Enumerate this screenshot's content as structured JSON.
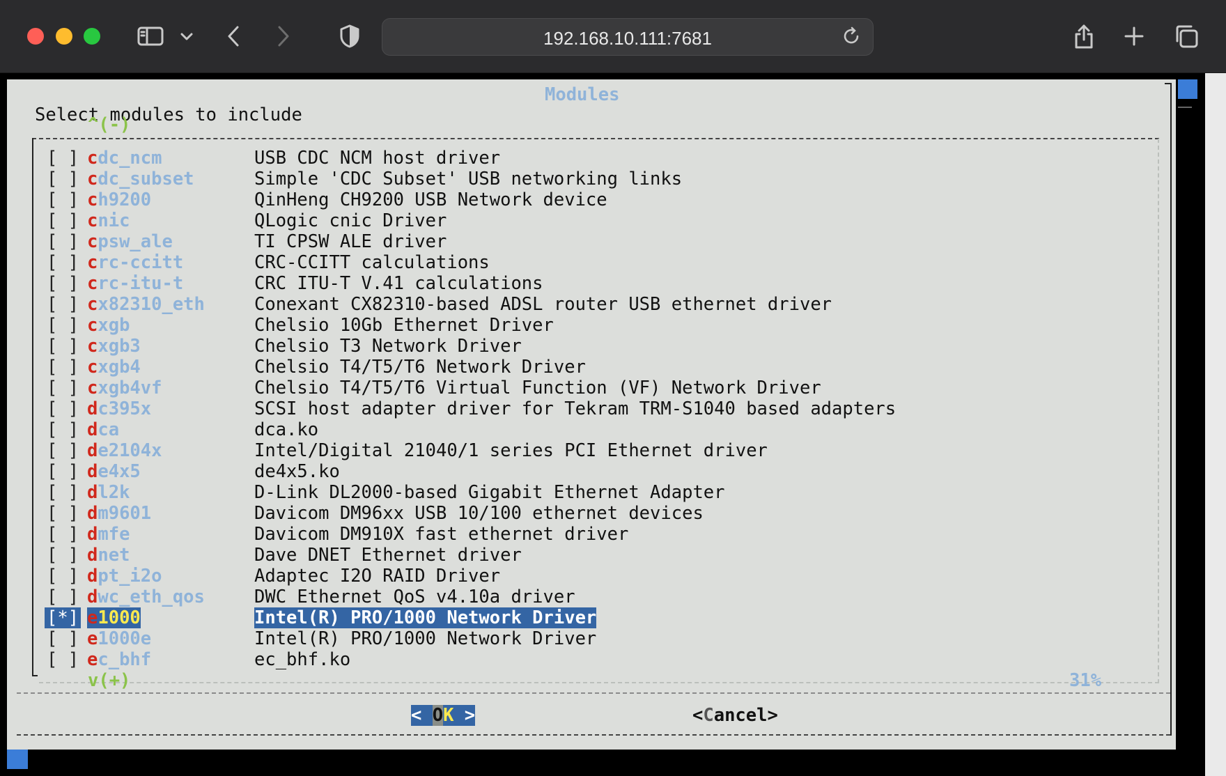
{
  "browser": {
    "url": "192.168.10.111:7681"
  },
  "dialog": {
    "title": "Modules",
    "prompt": "Select modules to include",
    "scroll_up": "^(-)",
    "scroll_down": "v(+)",
    "percent": "31%",
    "items": [
      {
        "checked": "[ ]",
        "hot": "c",
        "rest": "dc_ncm",
        "desc": "USB CDC NCM host driver",
        "selected": false
      },
      {
        "checked": "[ ]",
        "hot": "c",
        "rest": "dc_subset",
        "desc": "Simple 'CDC Subset' USB networking links",
        "selected": false
      },
      {
        "checked": "[ ]",
        "hot": "c",
        "rest": "h9200",
        "desc": "QinHeng CH9200 USB Network device",
        "selected": false
      },
      {
        "checked": "[ ]",
        "hot": "c",
        "rest": "nic",
        "desc": "QLogic cnic Driver",
        "selected": false
      },
      {
        "checked": "[ ]",
        "hot": "c",
        "rest": "psw_ale",
        "desc": "TI CPSW ALE driver",
        "selected": false
      },
      {
        "checked": "[ ]",
        "hot": "c",
        "rest": "rc-ccitt",
        "desc": "CRC-CCITT calculations",
        "selected": false
      },
      {
        "checked": "[ ]",
        "hot": "c",
        "rest": "rc-itu-t",
        "desc": "CRC ITU-T V.41 calculations",
        "selected": false
      },
      {
        "checked": "[ ]",
        "hot": "c",
        "rest": "x82310_eth",
        "desc": "Conexant CX82310-based ADSL router USB ethernet driver",
        "selected": false
      },
      {
        "checked": "[ ]",
        "hot": "c",
        "rest": "xgb",
        "desc": "Chelsio 10Gb Ethernet Driver",
        "selected": false
      },
      {
        "checked": "[ ]",
        "hot": "c",
        "rest": "xgb3",
        "desc": "Chelsio T3 Network Driver",
        "selected": false
      },
      {
        "checked": "[ ]",
        "hot": "c",
        "rest": "xgb4",
        "desc": "Chelsio T4/T5/T6 Network Driver",
        "selected": false
      },
      {
        "checked": "[ ]",
        "hot": "c",
        "rest": "xgb4vf",
        "desc": "Chelsio T4/T5/T6 Virtual Function (VF) Network Driver",
        "selected": false
      },
      {
        "checked": "[ ]",
        "hot": "d",
        "rest": "c395x",
        "desc": "SCSI host adapter driver for Tekram TRM-S1040 based adapters",
        "selected": false
      },
      {
        "checked": "[ ]",
        "hot": "d",
        "rest": "ca",
        "desc": "dca.ko",
        "selected": false
      },
      {
        "checked": "[ ]",
        "hot": "d",
        "rest": "e2104x",
        "desc": "Intel/Digital 21040/1 series PCI Ethernet driver",
        "selected": false
      },
      {
        "checked": "[ ]",
        "hot": "d",
        "rest": "e4x5",
        "desc": "de4x5.ko",
        "selected": false
      },
      {
        "checked": "[ ]",
        "hot": "d",
        "rest": "l2k",
        "desc": "D-Link DL2000-based Gigabit Ethernet Adapter",
        "selected": false
      },
      {
        "checked": "[ ]",
        "hot": "d",
        "rest": "m9601",
        "desc": "Davicom DM96xx USB 10/100 ethernet devices",
        "selected": false
      },
      {
        "checked": "[ ]",
        "hot": "d",
        "rest": "mfe",
        "desc": "Davicom DM910X fast ethernet driver",
        "selected": false
      },
      {
        "checked": "[ ]",
        "hot": "d",
        "rest": "net",
        "desc": "Dave DNET Ethernet driver",
        "selected": false
      },
      {
        "checked": "[ ]",
        "hot": "d",
        "rest": "pt_i2o",
        "desc": "Adaptec I2O RAID Driver",
        "selected": false
      },
      {
        "checked": "[ ]",
        "hot": "d",
        "rest": "wc_eth_qos",
        "desc": "DWC Ethernet QoS v4.10a driver",
        "selected": false
      },
      {
        "checked": "[*]",
        "hot": "e",
        "rest": "1000",
        "desc": "Intel(R) PRO/1000 Network Driver",
        "selected": true
      },
      {
        "checked": "[ ]",
        "hot": "e",
        "rest": "1000e",
        "desc": "Intel(R) PRO/1000 Network Driver",
        "selected": false
      },
      {
        "checked": "[ ]",
        "hot": "e",
        "rest": "c_bhf",
        "desc": "ec_bhf.ko",
        "selected": false
      }
    ],
    "ok_button": {
      "left": "< ",
      "hot": "O",
      "rest": "K",
      "right": " >"
    },
    "cancel_button": {
      "left": "<",
      "hot": "C",
      "rest": "ancel",
      "right": ">"
    }
  }
}
